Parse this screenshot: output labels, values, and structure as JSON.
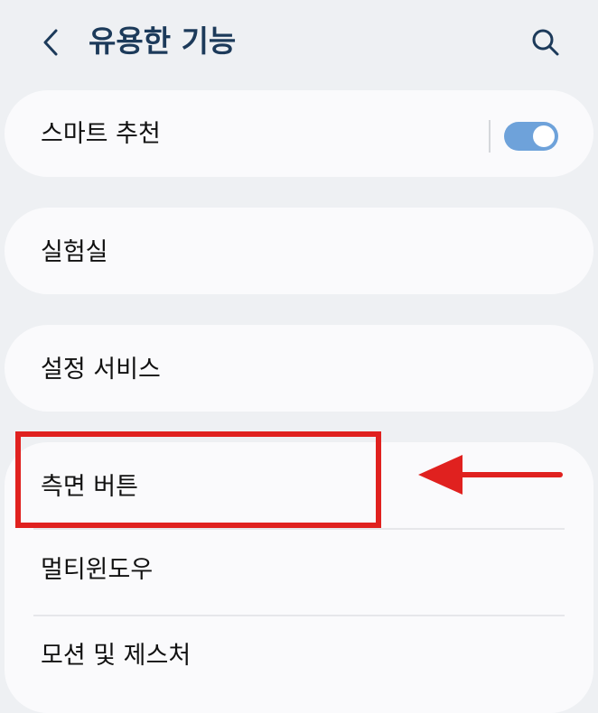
{
  "header": {
    "title": "유용한 기능",
    "back_icon": "chevron-left-icon",
    "search_icon": "search-icon"
  },
  "settings": {
    "smart_suggestions": {
      "label": "스마트 추천",
      "toggle_on": true
    },
    "labs": {
      "label": "실험실"
    },
    "settings_services": {
      "label": "설정 서비스"
    },
    "side_button": {
      "label": "측면 버튼"
    },
    "multi_window": {
      "label": "멀티윈도우"
    },
    "motions_gestures": {
      "label": "모션 및 제스처"
    }
  },
  "annotation": {
    "highlight_color": "#e0211f",
    "arrow_icon": "left-arrow-icon"
  },
  "colors": {
    "background": "#eef0f3",
    "card": "#fafafc",
    "title": "#1c3a5a",
    "toggle_on": "#6ea2da"
  }
}
